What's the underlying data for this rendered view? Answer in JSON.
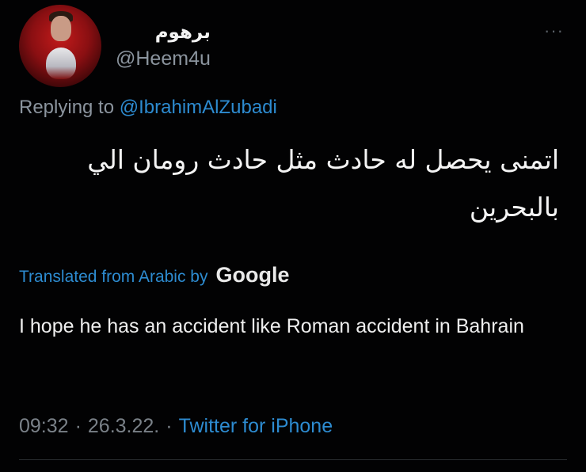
{
  "user": {
    "display_name": "برهوم",
    "handle": "@Heem4u",
    "avatar_icon": "avatar-driver-photo"
  },
  "menu": {
    "more_label": "···"
  },
  "reply": {
    "prefix": "Replying to ",
    "mention": "@IbrahimAlZubadi"
  },
  "tweet": {
    "text_arabic": "اتمنى يحصل له حادث مثل حادث رومان الي بالبحرين"
  },
  "translation": {
    "label": "Translated from Arabic by",
    "provider": "Google",
    "text": "I hope he has an accident like Roman accident in Bahrain"
  },
  "meta": {
    "time": "09:32",
    "sep1": "·",
    "date": "26.3.22.",
    "sep2": "·",
    "source": "Twitter for iPhone"
  },
  "colors": {
    "background": "#000000",
    "link": "#2d8bd0",
    "secondary_text": "#8b949e",
    "primary_text": "#e7e9ea"
  }
}
